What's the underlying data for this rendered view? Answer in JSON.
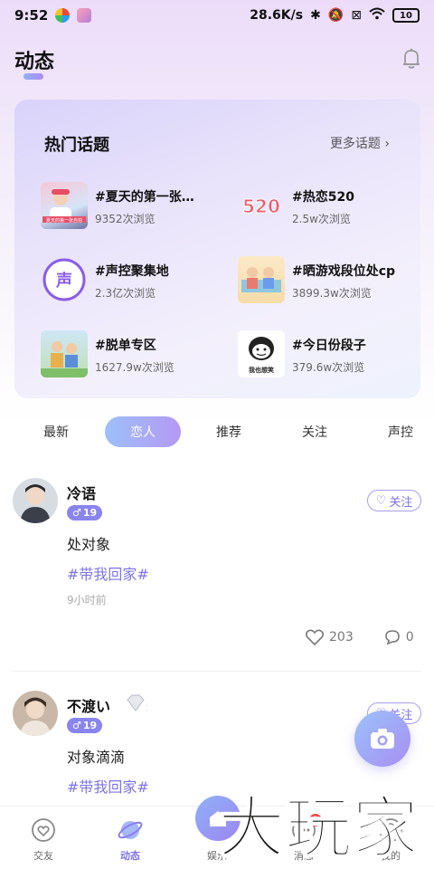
{
  "status_bar": {
    "time": "9:52",
    "network_speed": "28.6K/s",
    "battery": "10"
  },
  "header": {
    "title": "动态"
  },
  "hot_topics": {
    "title": "热门话题",
    "more_label": "更多话题",
    "items": [
      {
        "name": "#夏天的第一张…",
        "views": "9352次浏览",
        "thumb_text": "夏天的第一张自拍"
      },
      {
        "name": "#热恋520",
        "views": "2.5w次浏览",
        "thumb_text": "520"
      },
      {
        "name": "#声控聚集地",
        "views": "2.3亿次浏览",
        "thumb_text": "声"
      },
      {
        "name": "#晒游戏段位处cp",
        "views": "3899.3w次浏览",
        "thumb_text": ""
      },
      {
        "name": "#脱单专区",
        "views": "1627.9w次浏览",
        "thumb_text": ""
      },
      {
        "name": "#今日份段子",
        "views": "379.6w次浏览",
        "thumb_text": "我也想笑"
      }
    ]
  },
  "tabs": [
    "最新",
    "恋人",
    "推荐",
    "关注",
    "声控"
  ],
  "active_tab": "恋人",
  "posts": [
    {
      "user": "冷语",
      "age": "19",
      "follow_label": "关注",
      "text": "处对象",
      "tag": "#带我回家#",
      "time": "9小时前",
      "likes": "203",
      "comments": "0"
    },
    {
      "user": "不渡い",
      "age": "19",
      "follow_label": "关注",
      "text": "对象滴滴",
      "tag": "#带我回家#"
    }
  ],
  "bottom_nav": [
    {
      "label": "交友",
      "icon": "heart-icon"
    },
    {
      "label": "动态",
      "icon": "planet-icon"
    },
    {
      "label": "娱乐",
      "icon": "home-icon"
    },
    {
      "label": "消息",
      "icon": "message-icon",
      "badge": "2"
    },
    {
      "label": "我的",
      "icon": "profile-icon"
    }
  ],
  "watermark_text": "大玩家",
  "colors": {
    "accent": "#7d74e8",
    "gradient_start": "#9cc0fa",
    "gradient_end": "#b599f3"
  }
}
